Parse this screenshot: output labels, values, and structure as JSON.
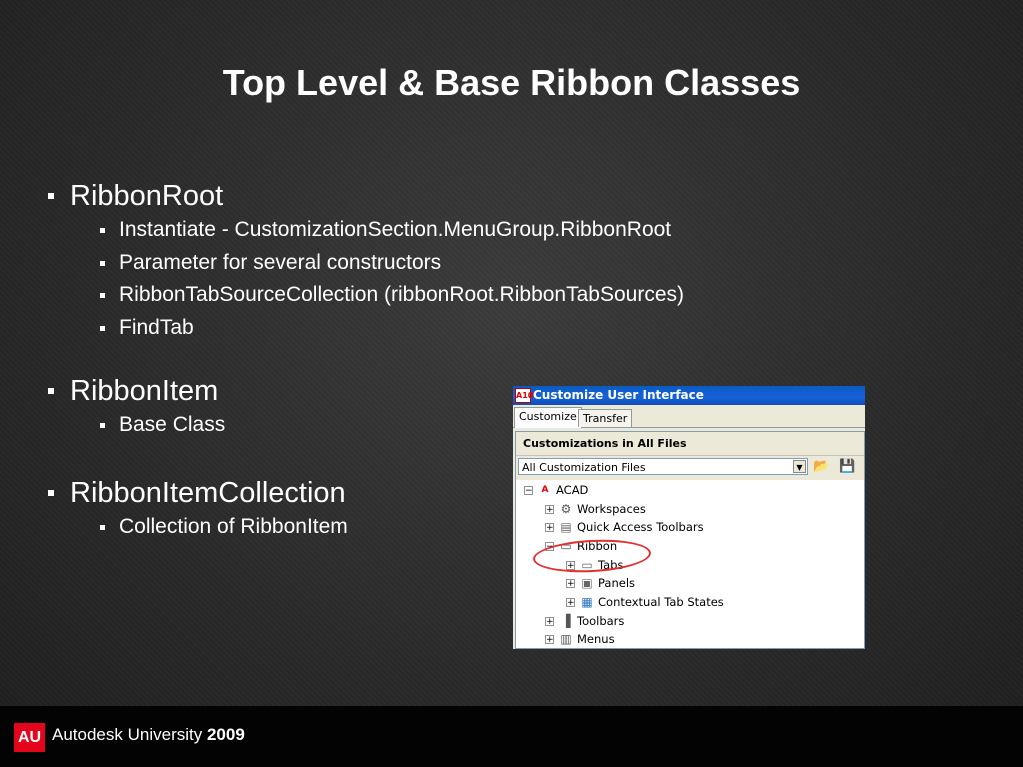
{
  "slide": {
    "title": "Top Level & Base Ribbon Classes"
  },
  "bullets": [
    {
      "text": "RibbonRoot",
      "sub": [
        "Instantiate - CustomizationSection.MenuGroup.RibbonRoot",
        "Parameter for several constructors",
        "RibbonTabSourceCollection (ribbonRoot.RibbonTabSources)",
        "FindTab"
      ]
    },
    {
      "text": "RibbonItem",
      "sub": [
        "Base Class"
      ]
    },
    {
      "text": "RibbonItemCollection",
      "sub": [
        "Collection of RibbonItem"
      ]
    }
  ],
  "cui": {
    "title": "Customize User Interface",
    "app_icon_text": "A10",
    "tabs": [
      "Customize",
      "Transfer"
    ],
    "panel_header": "Customizations in All Files",
    "combo_value": "All Customization Files",
    "tree": [
      {
        "label": "ACAD",
        "icon": "acad-app-icon",
        "expanded": true
      },
      {
        "label": "Workspaces",
        "icon": "gear-icon"
      },
      {
        "label": "Quick Access Toolbars",
        "icon": "toolbar-icon"
      },
      {
        "label": "Ribbon",
        "icon": "folder-icon",
        "expanded": true,
        "highlighted": true
      },
      {
        "label": "Tabs",
        "icon": "tabs-icon"
      },
      {
        "label": "Panels",
        "icon": "panels-icon"
      },
      {
        "label": "Contextual Tab States",
        "icon": "contextual-tab-icon"
      },
      {
        "label": "Toolbars",
        "icon": "toolbars-icon"
      },
      {
        "label": "Menus",
        "icon": "menus-icon"
      }
    ],
    "colors": {
      "titlebar": "#0a5bc4",
      "highlight": "#e03030"
    }
  },
  "footer": {
    "logo_text": "AU",
    "brand": "Autodesk University",
    "year": "2009",
    "logo_color": "#e3051b"
  }
}
